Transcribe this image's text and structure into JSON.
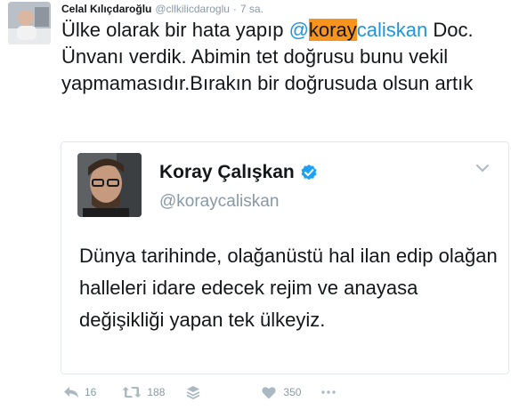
{
  "tweet": {
    "author_name": "Celal Kılıçdaroğlu",
    "author_handle": "@cllkilicdaroglu",
    "separator": "·",
    "timestamp": "7 sa.",
    "text_before": "Ülke olarak bir hata yapıp ",
    "mention_at": "@",
    "mention_highlight": "koray",
    "mention_rest": "caliskan",
    "text_after": " Doc. Ünvanı verdik. Abimin tet doğrusu bunu vekil yapmamasıdır.Bırakın bir doğrusuda olsun artık"
  },
  "quoted_tweet": {
    "name": "Koray Çalışkan",
    "handle": "@koraycaliskan",
    "text": "Dünya tarihinde, olağanüstü hal ilan edip olağan halleleri idare edecek rejim ve anayasa değişikliği yapan tek ülkeyiz."
  },
  "actions": {
    "reply_count": "16",
    "retweet_count": "188",
    "like_count": "350"
  },
  "colors": {
    "link": "#1b95e0",
    "highlight": "#f7941e",
    "muted": "#8899a6",
    "verified": "#1da1f2"
  }
}
